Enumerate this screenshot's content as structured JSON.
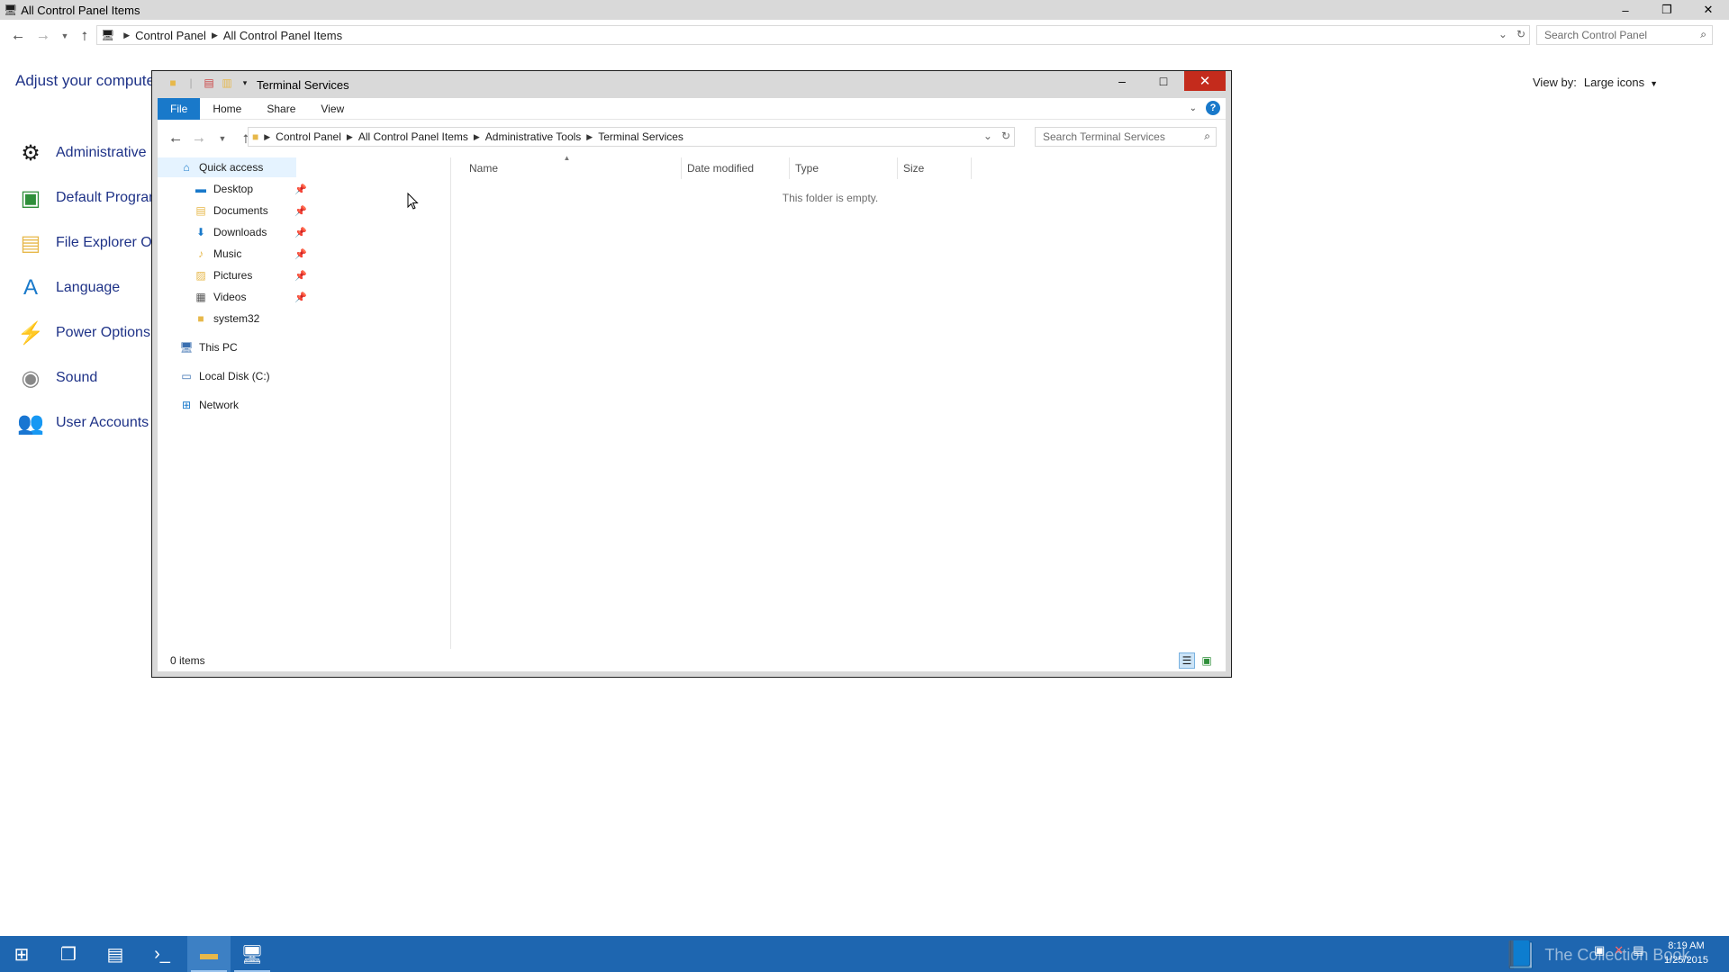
{
  "control_panel": {
    "window_title": "All Control Panel Items",
    "breadcrumb": [
      "Control Panel",
      "All Control Panel Items"
    ],
    "search_placeholder": "Search Control Panel",
    "heading": "Adjust your computer",
    "view_by_label": "View by:",
    "view_by_value": "Large icons",
    "items": [
      {
        "label": "Administrative",
        "icon": "administrative-tools-icon"
      },
      {
        "label": "Default Program",
        "icon": "default-programs-icon"
      },
      {
        "label": "File Explorer Op",
        "icon": "file-explorer-options-icon"
      },
      {
        "label": "Language",
        "icon": "language-icon"
      },
      {
        "label": "Power Options",
        "icon": "power-options-icon"
      },
      {
        "label": "Sound",
        "icon": "sound-icon"
      },
      {
        "label": "User Accounts",
        "icon": "user-accounts-icon"
      }
    ]
  },
  "explorer": {
    "title": "Terminal Services",
    "ribbon_tabs": [
      "File",
      "Home",
      "Share",
      "View"
    ],
    "breadcrumb": [
      "Control Panel",
      "All Control Panel Items",
      "Administrative Tools",
      "Terminal Services"
    ],
    "search_placeholder": "Search Terminal Services",
    "nav_pane": {
      "quick_access": "Quick access",
      "pinned": [
        "Desktop",
        "Documents",
        "Downloads",
        "Music",
        "Pictures",
        "Videos"
      ],
      "recent": [
        "system32"
      ],
      "this_pc": "This PC",
      "local_disk": "Local Disk (C:)",
      "network": "Network"
    },
    "columns": [
      "Name",
      "Date modified",
      "Type",
      "Size"
    ],
    "empty_message": "This folder is empty.",
    "status": "0 items"
  },
  "taskbar": {
    "watermark": "The Collection Book",
    "time": "8:19 AM",
    "date": "1/25/2015"
  },
  "colors": {
    "taskbar": "#1e66b0",
    "file_tab": "#1979ca",
    "close_button": "#c42b1c",
    "link_text": "#1e3287"
  }
}
